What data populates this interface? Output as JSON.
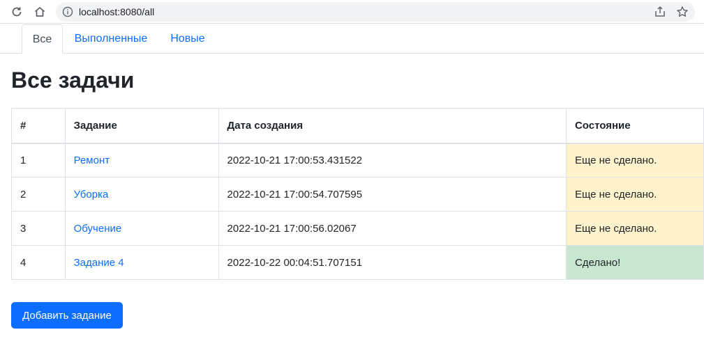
{
  "browser": {
    "url": "localhost:8080/all",
    "icons": [
      "reload-icon",
      "home-icon",
      "info-icon",
      "share-icon",
      "star-icon"
    ]
  },
  "tabs": [
    {
      "label": "Все",
      "active": true
    },
    {
      "label": "Выполненные",
      "active": false
    },
    {
      "label": "Новые",
      "active": false
    }
  ],
  "page": {
    "title": "Все задачи"
  },
  "table": {
    "headers": [
      "#",
      "Задание",
      "Дата создания",
      "Состояние"
    ],
    "rows": [
      {
        "num": "1",
        "task": "Ремонт",
        "created": "2022-10-21 17:00:53.431522",
        "status": "Еще не сделано.",
        "status_kind": "pending"
      },
      {
        "num": "2",
        "task": "Уборка",
        "created": "2022-10-21 17:00:54.707595",
        "status": "Еще не сделано.",
        "status_kind": "pending"
      },
      {
        "num": "3",
        "task": "Обучение",
        "created": "2022-10-21 17:00:56.02067",
        "status": "Еще не сделано.",
        "status_kind": "pending"
      },
      {
        "num": "4",
        "task": "Задание 4",
        "created": "2022-10-22 00:04:51.707151",
        "status": "Сделано!",
        "status_kind": "done"
      }
    ]
  },
  "actions": {
    "add_label": "Добавить задание"
  },
  "colors": {
    "link": "#0d6efd",
    "pending_bg": "#fff3cd",
    "done_bg": "#c9e7d0",
    "button_bg": "#0d6efd"
  }
}
